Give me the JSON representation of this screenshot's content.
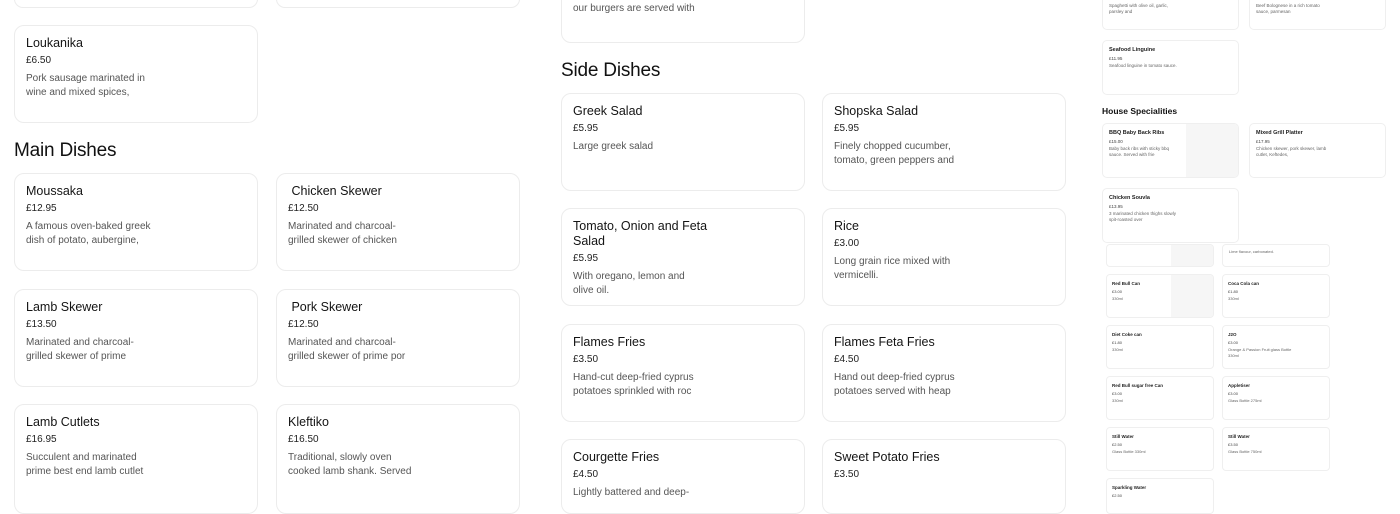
{
  "sections": {
    "main_dishes": "Main Dishes",
    "side_dishes": "Side Dishes",
    "house_specialities": "House Specialities"
  },
  "left_top": [
    {
      "name": "Loukanika",
      "price": "£6.50",
      "desc": "Pork sausage marinated in wine and mixed spices,"
    }
  ],
  "main_dishes": [
    {
      "name": "Moussaka",
      "price": "£12.95",
      "desc": "A famous oven-baked greek dish of potato, aubergine,"
    },
    {
      "name": " Chicken Skewer",
      "price": "£12.50",
      "desc": "Marinated and charcoal-grilled skewer of chicken"
    },
    {
      "name": "Lamb Skewer",
      "price": "£13.50",
      "desc": "Marinated and charcoal-grilled skewer of prime"
    },
    {
      "name": " Pork Skewer",
      "price": "£12.50",
      "desc": "Marinated and charcoal-grilled skewer of prime por"
    },
    {
      "name": "Lamb Cutlets",
      "price": "£16.95",
      "desc": "Succulent and marinated prime best end lamb cutlet"
    },
    {
      "name": "Kleftiko",
      "price": "£16.50",
      "desc": "Traditional, slowly oven cooked lamb shank. Served"
    }
  ],
  "burger_snippet": "our burgers are served with",
  "side_dishes": [
    {
      "name": "Greek Salad",
      "price": "£5.95",
      "desc": "Large greek salad"
    },
    {
      "name": "Shopska Salad",
      "price": "£5.95",
      "desc": "Finely chopped cucumber, tomato, green peppers and"
    },
    {
      "name": "Tomato, Onion and Feta Salad",
      "price": "£5.95",
      "desc": "With oregano, lemon and olive oil."
    },
    {
      "name": "Rice",
      "price": "£3.00",
      "desc": "Long grain rice mixed with vermicelli."
    },
    {
      "name": "Flames Fries",
      "price": "£3.50",
      "desc": "Hand-cut deep-fried cyprus potatoes sprinkled with roc"
    },
    {
      "name": "Flames Feta Fries",
      "price": "£4.50",
      "desc": "Hand out deep-fried cyprus potatoes served with heap"
    },
    {
      "name": "Courgette Fries",
      "price": "£4.50",
      "desc": "Lightly battered and deep-"
    },
    {
      "name": "Sweet Potato Fries",
      "price": "£3.50",
      "desc": ""
    }
  ],
  "mini": {
    "top_a": "Spaghetti with olive oil, garlic, parsley and",
    "top_b": "Beef Bolognese in a rich tomato sauce, parmesan",
    "seafood": {
      "name": "Seafood Linguine",
      "price": "£11.95",
      "desc": "Seafood linguine in tomato sauce."
    },
    "house": [
      {
        "name": "BBQ Baby Back Ribs",
        "price": "£15.00",
        "desc": "Baby back ribs with sticky bbq sauce. Served with frie"
      },
      {
        "name": "Mixed Grill Platter",
        "price": "£17.95",
        "desc": "Chicken skewer, pork skewer, lamb cutlet, Keftedes,"
      },
      {
        "name": "Chicken Souvla",
        "price": "£13.95",
        "desc": "3 marinated chicken thighs slowly spit-roasted over"
      }
    ],
    "drinks_snippet": "Lime flavour, carbonated.",
    "drinks": [
      {
        "name": "Red Bull Can",
        "price": "£3.00",
        "desc": "330ml"
      },
      {
        "name": "Coca Cola can",
        "price": "£1.80",
        "desc": "330ml"
      },
      {
        "name": "Diet Coke can",
        "price": "£1.80",
        "desc": "330ml"
      },
      {
        "name": "J2O",
        "price": "£3.00",
        "desc": "Orange & Passion Fruit glass Bottle 330ml"
      },
      {
        "name": "Red Bull sugar free Can",
        "price": "£3.00",
        "desc": "330ml"
      },
      {
        "name": "Appletiser",
        "price": "£3.00",
        "desc": "Glass Bottle 275ml"
      },
      {
        "name": "Still Water",
        "price": "£2.50",
        "desc": "Glass Bottle 330ml"
      },
      {
        "name": "Still Water",
        "price": "£3.50",
        "desc": "Glass Bottle 750ml"
      },
      {
        "name": "Sparkling Water",
        "price": "£2.50",
        "desc": ""
      }
    ]
  }
}
